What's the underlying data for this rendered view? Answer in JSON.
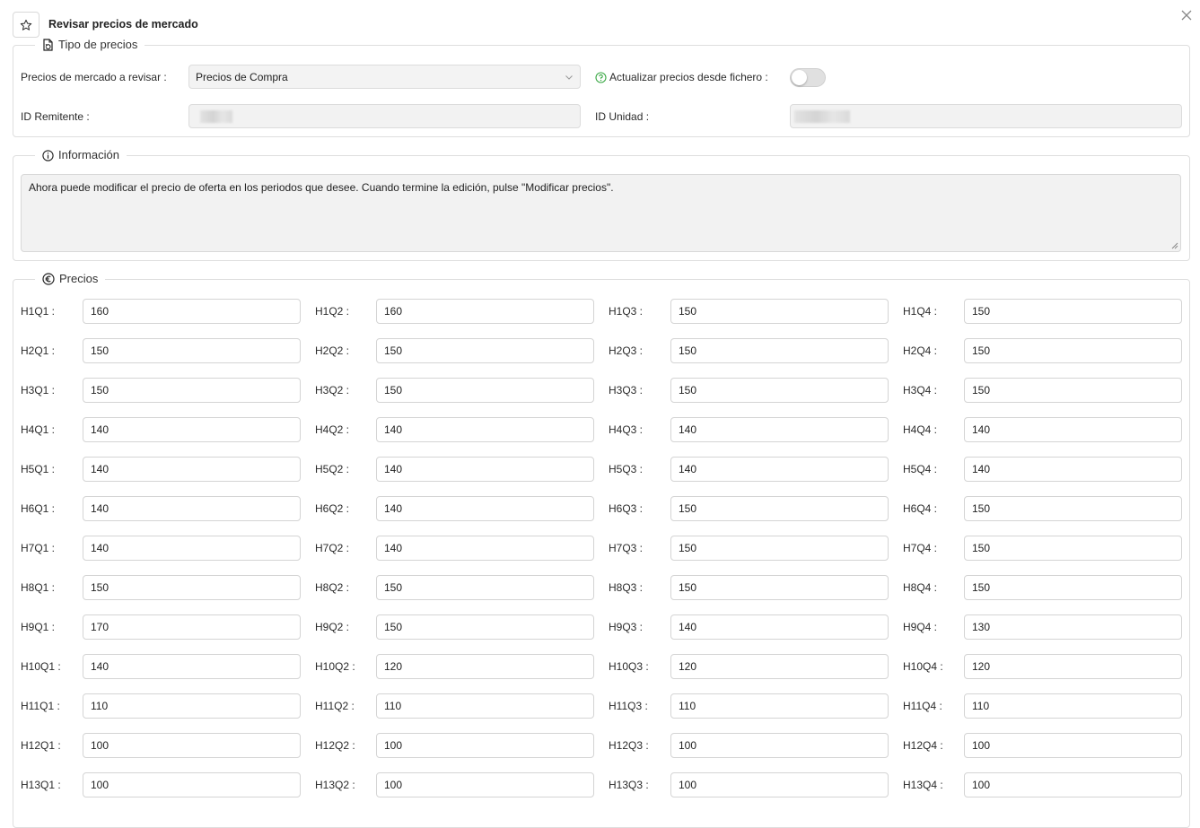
{
  "dialog": {
    "title": "Revisar precios de mercado"
  },
  "icons": {
    "star": "star-icon",
    "close": "close-icon",
    "file": "file-refresh-icon",
    "info": "info-icon",
    "euro": "euro-icon",
    "help": "help-circle-icon",
    "chevron": "chevron-down-icon"
  },
  "colors": {
    "help_icon": "#3aa845",
    "border": "#dedede",
    "readonly_bg": "#f2f2f2"
  },
  "tipo": {
    "legend": "Tipo de precios",
    "market_label": "Precios de mercado a revisar :",
    "market_value": "Precios de Compra",
    "update_label": "Actualizar precios desde fichero :",
    "update_enabled": false,
    "sender_label": "ID Remitente :",
    "unit_label": "ID Unidad :"
  },
  "info": {
    "legend": "Información",
    "message": "Ahora puede modificar el precio de oferta en los periodos que desee. Cuando termine la edición, pulse \"Modificar precios\"."
  },
  "precios": {
    "legend": "Precios",
    "rows": [
      [
        {
          "label": "H1Q1 :",
          "value": "160"
        },
        {
          "label": "H1Q2 :",
          "value": "160"
        },
        {
          "label": "H1Q3 :",
          "value": "150"
        },
        {
          "label": "H1Q4 :",
          "value": "150"
        }
      ],
      [
        {
          "label": "H2Q1 :",
          "value": "150"
        },
        {
          "label": "H2Q2 :",
          "value": "150"
        },
        {
          "label": "H2Q3 :",
          "value": "150"
        },
        {
          "label": "H2Q4 :",
          "value": "150"
        }
      ],
      [
        {
          "label": "H3Q1 :",
          "value": "150"
        },
        {
          "label": "H3Q2 :",
          "value": "150"
        },
        {
          "label": "H3Q3 :",
          "value": "150"
        },
        {
          "label": "H3Q4 :",
          "value": "150"
        }
      ],
      [
        {
          "label": "H4Q1 :",
          "value": "140"
        },
        {
          "label": "H4Q2 :",
          "value": "140"
        },
        {
          "label": "H4Q3 :",
          "value": "140"
        },
        {
          "label": "H4Q4 :",
          "value": "140"
        }
      ],
      [
        {
          "label": "H5Q1 :",
          "value": "140"
        },
        {
          "label": "H5Q2 :",
          "value": "140"
        },
        {
          "label": "H5Q3 :",
          "value": "140"
        },
        {
          "label": "H5Q4 :",
          "value": "140"
        }
      ],
      [
        {
          "label": "H6Q1 :",
          "value": "140"
        },
        {
          "label": "H6Q2 :",
          "value": "140"
        },
        {
          "label": "H6Q3 :",
          "value": "150"
        },
        {
          "label": "H6Q4 :",
          "value": "150"
        }
      ],
      [
        {
          "label": "H7Q1 :",
          "value": "140"
        },
        {
          "label": "H7Q2 :",
          "value": "140"
        },
        {
          "label": "H7Q3 :",
          "value": "150"
        },
        {
          "label": "H7Q4 :",
          "value": "150"
        }
      ],
      [
        {
          "label": "H8Q1 :",
          "value": "150"
        },
        {
          "label": "H8Q2 :",
          "value": "150"
        },
        {
          "label": "H8Q3 :",
          "value": "150"
        },
        {
          "label": "H8Q4 :",
          "value": "150"
        }
      ],
      [
        {
          "label": "H9Q1 :",
          "value": "170"
        },
        {
          "label": "H9Q2 :",
          "value": "150"
        },
        {
          "label": "H9Q3 :",
          "value": "140"
        },
        {
          "label": "H9Q4 :",
          "value": "130"
        }
      ],
      [
        {
          "label": "H10Q1 :",
          "value": "140"
        },
        {
          "label": "H10Q2 :",
          "value": "120"
        },
        {
          "label": "H10Q3 :",
          "value": "120"
        },
        {
          "label": "H10Q4 :",
          "value": "120"
        }
      ],
      [
        {
          "label": "H11Q1 :",
          "value": "110"
        },
        {
          "label": "H11Q2 :",
          "value": "110"
        },
        {
          "label": "H11Q3 :",
          "value": "110"
        },
        {
          "label": "H11Q4 :",
          "value": "110"
        }
      ],
      [
        {
          "label": "H12Q1 :",
          "value": "100"
        },
        {
          "label": "H12Q2 :",
          "value": "100"
        },
        {
          "label": "H12Q3 :",
          "value": "100"
        },
        {
          "label": "H12Q4 :",
          "value": "100"
        }
      ],
      [
        {
          "label": "H13Q1 :",
          "value": "100"
        },
        {
          "label": "H13Q2 :",
          "value": "100"
        },
        {
          "label": "H13Q3 :",
          "value": "100"
        },
        {
          "label": "H13Q4 :",
          "value": "100"
        }
      ]
    ]
  }
}
